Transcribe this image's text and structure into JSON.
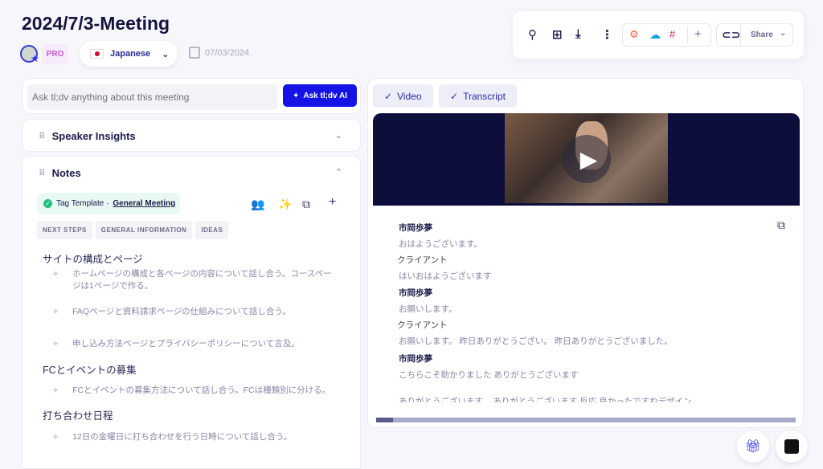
{
  "header": {
    "title": "2024/7/3-Meeting",
    "plan_badge": "PRO",
    "language": "Japanese",
    "date": "07/03/2024"
  },
  "toolbar": {
    "share_label": "Share",
    "icons": [
      "search-icon",
      "folder-add-icon",
      "download-icon",
      "more-icon",
      "hubspot-icon",
      "salesforce-icon",
      "slack-icon",
      "plus-icon",
      "link-icon"
    ]
  },
  "ask": {
    "placeholder": "Ask tl;dv anything about this meeting",
    "button_label": "Ask tl;dv AI",
    "accent": "#1414e6"
  },
  "speaker_insights": {
    "title": "Speaker Insights"
  },
  "notes": {
    "title": "Notes",
    "tag_prefix": "Tag Template ·",
    "template_name": "General Meeting",
    "chips": [
      "NEXT STEPS",
      "GENERAL INFORMATION",
      "IDEAS"
    ],
    "sections": [
      {
        "heading": "サイトの構成とページ",
        "items": [
          "ホームページの構成と各ページの内容について話し合う。コースページは1ページで作る。",
          "FAQページと資料請求ページの仕組みについて話し合う。",
          "申し込み方法ページとプライバシーポリシーについて言及。"
        ]
      },
      {
        "heading": "FCとイベントの募集",
        "items": [
          "FCとイベントの募集方法について話し合う。FCは種類別に分ける。"
        ]
      },
      {
        "heading": "打ち合わせ日程",
        "items": [
          "12日の金曜日に打ち合わせを行う日時について話し合う。"
        ]
      }
    ]
  },
  "tabs": [
    {
      "label": "Video"
    },
    {
      "label": "Transcript"
    }
  ],
  "transcript": [
    {
      "speaker": "市岡歩夢",
      "text": "おはようございます。"
    },
    {
      "speaker": "クライアント",
      "text": "はいおはようございます"
    },
    {
      "speaker": "市岡歩夢",
      "text": "お願いします。"
    },
    {
      "speaker": "クライアント",
      "text": "お願いします。 昨日ありがとうござい。 昨日ありがとうございました。"
    },
    {
      "speaker": "市岡歩夢",
      "text": "こちらこそ助かりました ありがとうございます"
    },
    {
      "speaker": "",
      "text": "ありがとうございます。 ありがとうございます 反応 良かったですねデザイン"
    }
  ],
  "playback": {
    "progress_percent": 4
  }
}
